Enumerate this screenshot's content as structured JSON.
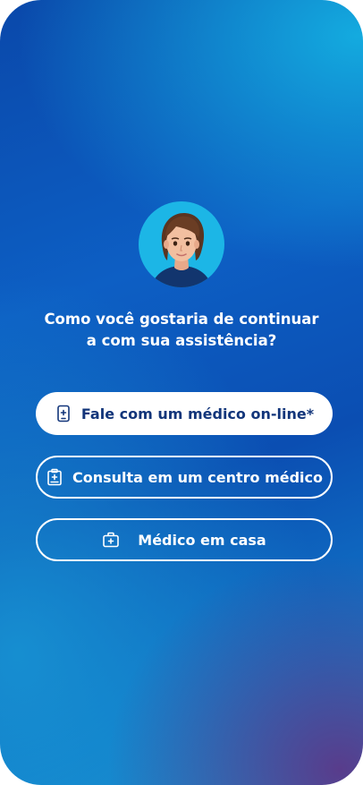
{
  "prompt": {
    "line1": "Como você gostaria de continuar",
    "line2": "a com sua assistência?"
  },
  "options": [
    {
      "label": "Fale com um médico on-line*",
      "icon": "phone-doctor-icon",
      "style": "filled"
    },
    {
      "label": "Consulta em um centro médico",
      "icon": "clinic-icon",
      "style": "outline"
    },
    {
      "label": "Médico em casa",
      "icon": "medical-kit-icon",
      "style": "outline"
    }
  ],
  "avatar": {
    "icon": "assistant-avatar",
    "background": "#1cb6e6"
  },
  "colors": {
    "primary_text": "#12357a",
    "gradient_top": "#14afe1",
    "gradient_mid": "#0b4eb2",
    "gradient_bottom_right": "#5c3888"
  }
}
